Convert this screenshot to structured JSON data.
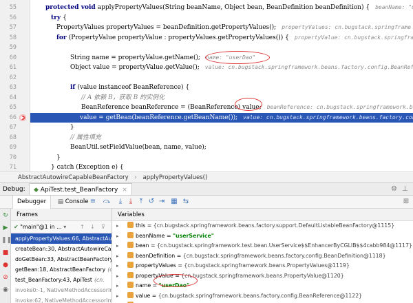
{
  "editor": {
    "line_numbers": [
      "55",
      "56",
      "57",
      "58",
      "59",
      "60",
      "61",
      "62",
      "63",
      "64",
      "65",
      "66",
      "67",
      "68",
      "69",
      "70",
      "71"
    ],
    "lines": [
      {
        "code_kw": "protected void ",
        "code": "applyPropertyValues(String beanName, Object bean, BeanDefinition beanDefinition) {",
        "hint": "beanName: \"userSe"
      },
      {
        "code_kw": "try ",
        "code": "{",
        "hint": ""
      },
      {
        "code_kw": "",
        "code": "PropertyValues propertyValues = beanDefinition.getPropertyValues();",
        "hint": "propertyValues: cn.bugstack.springframe"
      },
      {
        "code_kw": "for ",
        "code": "(PropertyValue propertyValue : propertyValues.getPropertyValues()) {",
        "hint": "propertyValue: cn.bugstack.springfra"
      },
      {
        "code_kw": "",
        "code": "",
        "hint": ""
      },
      {
        "code_kw": "",
        "code": "String name = propertyValue.getName();",
        "hint": "name: \"userDao\""
      },
      {
        "code_kw": "",
        "code": "Object value = propertyValue.getValue();",
        "hint": "value: cn.bugstack.springframework.beans.factory.config.BeanRef"
      },
      {
        "code_kw": "",
        "code": "",
        "hint": ""
      },
      {
        "code_kw": "if ",
        "code": "(value instanceof BeanReference) {",
        "hint": ""
      },
      {
        "code_kw": "",
        "code": "// A 依赖 B，获取 B 的实例化",
        "hint": ""
      },
      {
        "code_kw": "",
        "code": "BeanReference beanReference = (BeanReference) value;",
        "hint": "beanReference: cn.bugstack.springframework.beans.f"
      },
      {
        "code_kw": "",
        "code": "value = getBean(beanReference.getBeanName());",
        "hint": "value: cn.bugstack.springframework.beans.factory.conf"
      },
      {
        "code_kw": "",
        "code": "}",
        "hint": ""
      },
      {
        "code_kw": "",
        "code": "// 属性填充",
        "hint": ""
      },
      {
        "code_kw": "",
        "code": "BeanUtil.setFieldValue(bean, name, value);",
        "hint": ""
      },
      {
        "code_kw": "",
        "code": "}",
        "hint": ""
      },
      {
        "code_kw": "",
        "code": "} catch (Exception e) {",
        "hint": ""
      }
    ]
  },
  "breadcrumb": {
    "items": [
      "AbstractAutowireCapableBeanFactory",
      "applyPropertyValues()"
    ],
    "separator": "›"
  },
  "debug": {
    "label": "Debug:",
    "session": "ApiTest.test_BeanFactory"
  },
  "toolbar": {
    "tabs": [
      "Debugger",
      "Console"
    ],
    "icons": [
      "console-icon",
      "step-over-icon",
      "step-into-icon",
      "force-step-into-icon",
      "step-out-icon",
      "drop-frame-icon",
      "run-to-cursor-icon",
      "evaluate-icon",
      "trace-icon",
      "restore-layout-icon"
    ]
  },
  "frames": {
    "header": "Frames",
    "thread": "\"main\"@1 in ...",
    "items": [
      {
        "method": "applyPropertyValues:66, AbstractAut",
        "loc": "",
        "selected": true,
        "lib": false
      },
      {
        "method": "createBean:30, AbstractAutowireCap",
        "loc": "",
        "selected": false,
        "lib": false
      },
      {
        "method": "doGetBean:33, AbstractBeanFactory",
        "loc": "",
        "selected": false,
        "lib": false
      },
      {
        "method": "getBean:18, AbstractBeanFactory",
        "loc": "(c",
        "selected": false,
        "lib": false
      },
      {
        "method": "test_BeanFactory:43, ApiTest",
        "loc": "(cn.",
        "selected": false,
        "lib": false
      },
      {
        "method": "invoke0:-1, NativeMethodAccessorIm",
        "loc": "",
        "selected": false,
        "lib": true
      },
      {
        "method": "invoke:62, NativeMethodAccessorIm",
        "loc": "",
        "selected": false,
        "lib": true
      }
    ]
  },
  "variables": {
    "header": "Variables",
    "items": [
      {
        "name": "this",
        "value": "{cn.bugstack.springframework.beans.factory.support.DefaultListableBeanFactory@1115}",
        "str": false,
        "color": "#e8a33c"
      },
      {
        "name": "beanName",
        "value": "\"userService\"",
        "str": true,
        "color": "#e8a33c"
      },
      {
        "name": "bean",
        "value": "{cn.bugstack.springframework.test.bean.UserService$$EnhancerByCGLIB$$4cabb984@1117}",
        "str": false,
        "color": "#e8a33c"
      },
      {
        "name": "beanDefinition",
        "value": "{cn.bugstack.springframework.beans.factory.config.BeanDefinition@1118}",
        "str": false,
        "color": "#e8a33c"
      },
      {
        "name": "propertyValues",
        "value": "{cn.bugstack.springframework.beans.PropertyValues@1119}",
        "str": false,
        "color": "#e8a33c"
      },
      {
        "name": "propertyValue",
        "value": "{cn.bugstack.springframework.beans.PropertyValue@1120}",
        "str": false,
        "color": "#e8a33c"
      },
      {
        "name": "name",
        "value": "\"userDao\"",
        "str": true,
        "color": "#e8a33c"
      },
      {
        "name": "value",
        "value": "{cn.bugstack.springframework.beans.factory.config.BeanReference@1122}",
        "str": false,
        "color": "#e8a33c"
      },
      {
        "name": "beanReference",
        "value": "{cn.bugstack.springframework.beans.factory.config.BeanReference@1122}",
        "str": false,
        "color": "#e8a33c"
      }
    ]
  },
  "colors": {
    "accent": "#2a56b5",
    "breakpoint": "#d33",
    "string": "#008000"
  }
}
